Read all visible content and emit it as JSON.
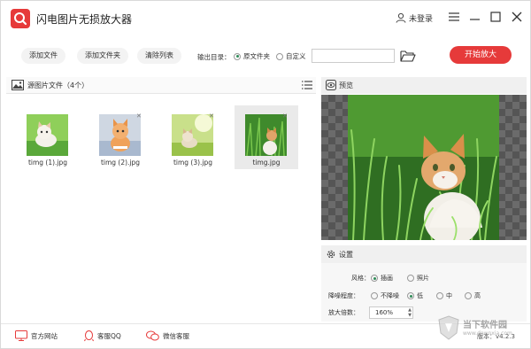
{
  "app": {
    "title": "闪电图片无损放大器",
    "brand_color": "#e63a3a"
  },
  "titlebar": {
    "user_label": "未登录"
  },
  "toolbar": {
    "add_file": "添加文件",
    "add_folder": "添加文件夹",
    "clear_list": "清除列表",
    "output_label": "输出目录：",
    "opt_source_folder": "原文件夹",
    "opt_custom": "自定义",
    "path_value": "",
    "start_label": "开始放大"
  },
  "left": {
    "header": "源图片文件（4个）",
    "files": [
      {
        "name": "timg (1).jpg"
      },
      {
        "name": "timg (2).jpg"
      },
      {
        "name": "timg (3).jpg"
      },
      {
        "name": "timg.jpg",
        "selected": true
      }
    ]
  },
  "preview": {
    "header": "预览"
  },
  "settings": {
    "header": "设置",
    "style_label": "风格：",
    "style_options": [
      "插画",
      "照片"
    ],
    "style_selected": "插画",
    "denoise_label": "降噪程度：",
    "denoise_options": [
      "不降噪",
      "低",
      "中",
      "高"
    ],
    "denoise_selected": "低",
    "scale_label": "放大倍数：",
    "scale_value": "160%"
  },
  "status": {
    "website": "官方网站",
    "qq": "客服QQ",
    "wechat": "微信客服",
    "version": "版本：v4.2.3"
  },
  "watermark": {
    "text": "当下软件园",
    "url": "www.downxia.com"
  }
}
